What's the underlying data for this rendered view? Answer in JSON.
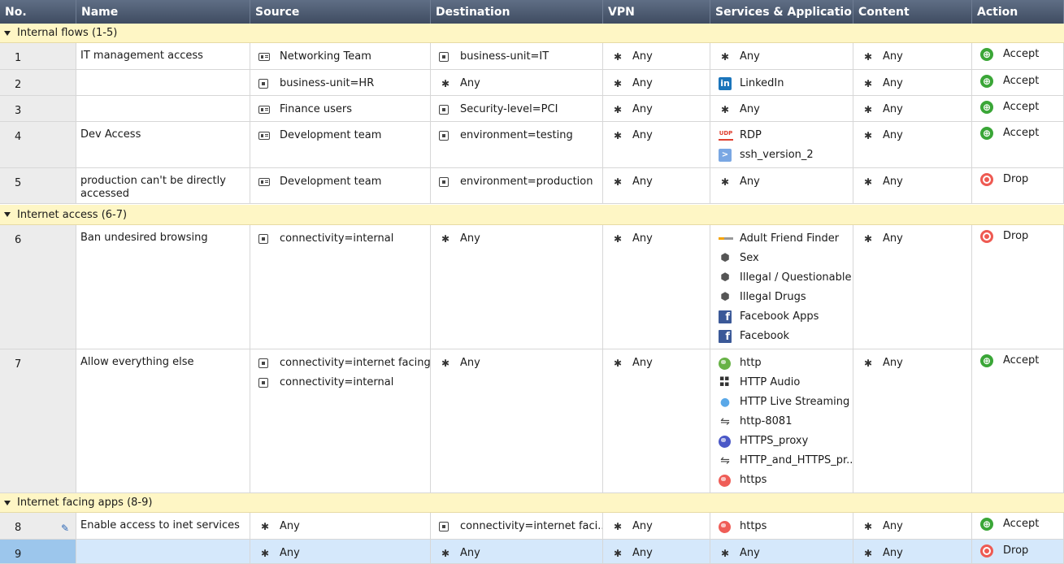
{
  "columns": [
    {
      "label": "No."
    },
    {
      "label": "Name"
    },
    {
      "label": "Source"
    },
    {
      "label": "Destination"
    },
    {
      "label": "VPN"
    },
    {
      "label": "Services & Applications"
    },
    {
      "label": "Content"
    },
    {
      "label": "Action"
    }
  ],
  "sections": [
    {
      "label": "Internal flows",
      "range": "(1-5)",
      "rules": [
        {
          "no": "1",
          "name": "IT management access",
          "source": [
            {
              "icon": "user-group-icon",
              "text": "Networking Team"
            }
          ],
          "destination": [
            {
              "icon": "tag-icon",
              "text": "business-unit=IT"
            }
          ],
          "vpn": [
            {
              "icon": "any-icon",
              "text": "Any"
            }
          ],
          "services": [
            {
              "icon": "any-icon",
              "text": "Any"
            }
          ],
          "content": [
            {
              "icon": "any-icon",
              "text": "Any"
            }
          ],
          "action": {
            "icon": "accept-icon",
            "text": "Accept"
          }
        },
        {
          "no": "2",
          "name": "",
          "source": [
            {
              "icon": "tag-icon",
              "text": "business-unit=HR"
            }
          ],
          "destination": [
            {
              "icon": "any-icon",
              "text": "Any"
            }
          ],
          "vpn": [
            {
              "icon": "any-icon",
              "text": "Any"
            }
          ],
          "services": [
            {
              "icon": "linkedin-icon",
              "text": "LinkedIn"
            }
          ],
          "content": [
            {
              "icon": "any-icon",
              "text": "Any"
            }
          ],
          "action": {
            "icon": "accept-icon",
            "text": "Accept"
          }
        },
        {
          "no": "3",
          "name": "",
          "source": [
            {
              "icon": "user-group-icon",
              "text": "Finance users"
            }
          ],
          "destination": [
            {
              "icon": "tag-icon",
              "text": "Security-level=PCI"
            }
          ],
          "vpn": [
            {
              "icon": "any-icon",
              "text": "Any"
            }
          ],
          "services": [
            {
              "icon": "any-icon",
              "text": "Any"
            }
          ],
          "content": [
            {
              "icon": "any-icon",
              "text": "Any"
            }
          ],
          "action": {
            "icon": "accept-icon",
            "text": "Accept"
          }
        },
        {
          "no": "4",
          "name": "Dev Access",
          "source": [
            {
              "icon": "user-group-icon",
              "text": "Development team"
            }
          ],
          "destination": [
            {
              "icon": "tag-icon",
              "text": "environment=testing"
            }
          ],
          "vpn": [
            {
              "icon": "any-icon",
              "text": "Any"
            }
          ],
          "services": [
            {
              "icon": "udp-icon",
              "text": "RDP"
            },
            {
              "icon": "terminal-icon",
              "text": "ssh_version_2"
            }
          ],
          "content": [
            {
              "icon": "any-icon",
              "text": "Any"
            }
          ],
          "action": {
            "icon": "accept-icon",
            "text": "Accept"
          }
        },
        {
          "no": "5",
          "name": "production can't be directly accessed",
          "source": [
            {
              "icon": "user-group-icon",
              "text": "Development team"
            }
          ],
          "destination": [
            {
              "icon": "tag-icon",
              "text": "environment=production"
            }
          ],
          "vpn": [
            {
              "icon": "any-icon",
              "text": "Any"
            }
          ],
          "services": [
            {
              "icon": "any-icon",
              "text": "Any"
            }
          ],
          "content": [
            {
              "icon": "any-icon",
              "text": "Any"
            }
          ],
          "action": {
            "icon": "drop-icon",
            "text": "Drop"
          }
        }
      ]
    },
    {
      "label": "Internet access",
      "range": "(6-7)",
      "rules": [
        {
          "no": "6",
          "name": "Ban undesired browsing",
          "source": [
            {
              "icon": "tag-icon",
              "text": "connectivity=internal"
            }
          ],
          "destination": [
            {
              "icon": "any-icon",
              "text": "Any"
            }
          ],
          "vpn": [
            {
              "icon": "any-icon",
              "text": "Any"
            }
          ],
          "services": [
            {
              "icon": "adult-site-icon",
              "text": "Adult Friend Finder"
            },
            {
              "icon": "category-tag-icon",
              "text": "Sex"
            },
            {
              "icon": "category-tag-icon",
              "text": "Illegal / Questionable"
            },
            {
              "icon": "category-tag-icon",
              "text": "Illegal Drugs"
            },
            {
              "icon": "facebook-icon",
              "text": "Facebook Apps"
            },
            {
              "icon": "facebook-icon",
              "text": "Facebook"
            }
          ],
          "content": [
            {
              "icon": "any-icon",
              "text": "Any"
            }
          ],
          "action": {
            "icon": "drop-icon",
            "text": "Drop"
          }
        },
        {
          "no": "7",
          "name": "Allow everything else",
          "source": [
            {
              "icon": "tag-icon",
              "text": "connectivity=internet facing"
            },
            {
              "icon": "tag-icon",
              "text": "connectivity=internal"
            }
          ],
          "destination": [
            {
              "icon": "any-icon",
              "text": "Any"
            }
          ],
          "vpn": [
            {
              "icon": "any-icon",
              "text": "Any"
            }
          ],
          "services": [
            {
              "icon": "globe-green-icon",
              "text": "http"
            },
            {
              "icon": "windows-icon",
              "text": "HTTP Audio"
            },
            {
              "icon": "apple-icon",
              "text": "HTTP Live Streaming"
            },
            {
              "icon": "arrows-icon",
              "text": "http-8081"
            },
            {
              "icon": "globe-blue-icon",
              "text": "HTTPS_proxy"
            },
            {
              "icon": "arrows-icon",
              "text": "HTTP_and_HTTPS_pr..."
            },
            {
              "icon": "globe-red-icon",
              "text": "https"
            }
          ],
          "content": [
            {
              "icon": "any-icon",
              "text": "Any"
            }
          ],
          "action": {
            "icon": "accept-icon",
            "text": "Accept"
          }
        }
      ]
    },
    {
      "label": "Internet facing apps",
      "range": "(8-9)",
      "rules": [
        {
          "no": "8",
          "name": "Enable access to inet services",
          "edited": true,
          "source": [
            {
              "icon": "any-icon",
              "text": "Any"
            }
          ],
          "destination": [
            {
              "icon": "tag-icon",
              "text": "connectivity=internet faci..."
            }
          ],
          "vpn": [
            {
              "icon": "any-icon",
              "text": "Any"
            }
          ],
          "services": [
            {
              "icon": "globe-red-icon",
              "text": "https"
            }
          ],
          "content": [
            {
              "icon": "any-icon",
              "text": "Any"
            }
          ],
          "action": {
            "icon": "accept-icon",
            "text": "Accept"
          }
        },
        {
          "no": "9",
          "name": "",
          "selected": true,
          "source": [
            {
              "icon": "any-icon",
              "text": "Any"
            }
          ],
          "destination": [
            {
              "icon": "any-icon",
              "text": "Any"
            }
          ],
          "vpn": [
            {
              "icon": "any-icon",
              "text": "Any"
            }
          ],
          "services": [
            {
              "icon": "any-icon",
              "text": "Any"
            }
          ],
          "content": [
            {
              "icon": "any-icon",
              "text": "Any"
            }
          ],
          "action": {
            "icon": "drop-icon",
            "text": "Drop"
          }
        }
      ]
    }
  ]
}
